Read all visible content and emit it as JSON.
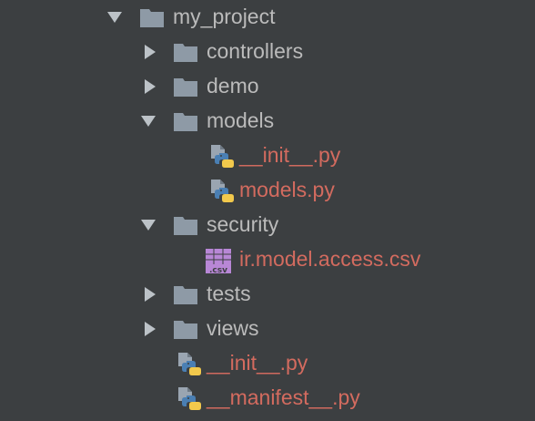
{
  "theme": {
    "background": "#3c3f41",
    "text": "#bbbbbb",
    "modified_text": "#d36b5f",
    "folder": "#8e9aa6",
    "arrow": "#bcc2c7",
    "python_blue": "#4a7fb3",
    "python_yellow": "#f2c94c",
    "csv_purple": "#b887d6"
  },
  "tree": [
    {
      "label": "my_project",
      "type": "folder",
      "expanded": true,
      "icon": "folder-icon"
    },
    {
      "label": "controllers",
      "type": "folder",
      "expanded": false,
      "icon": "folder-icon"
    },
    {
      "label": "demo",
      "type": "folder",
      "expanded": false,
      "icon": "folder-icon"
    },
    {
      "label": "models",
      "type": "folder",
      "expanded": true,
      "icon": "folder-icon"
    },
    {
      "label": "__init__.py",
      "type": "file",
      "icon": "python-file-icon",
      "modified": true
    },
    {
      "label": "models.py",
      "type": "file",
      "icon": "python-file-icon",
      "modified": true
    },
    {
      "label": "security",
      "type": "folder",
      "expanded": true,
      "icon": "folder-icon"
    },
    {
      "label": "ir.model.access.csv",
      "type": "file",
      "icon": "csv-file-icon",
      "icon_text": ".csv",
      "modified": true
    },
    {
      "label": "tests",
      "type": "folder",
      "expanded": false,
      "icon": "folder-icon"
    },
    {
      "label": "views",
      "type": "folder",
      "expanded": false,
      "icon": "folder-icon"
    },
    {
      "label": "__init__.py",
      "type": "file",
      "icon": "python-file-icon",
      "modified": true
    },
    {
      "label": "__manifest__.py",
      "type": "file",
      "icon": "python-file-icon",
      "modified": true
    }
  ]
}
